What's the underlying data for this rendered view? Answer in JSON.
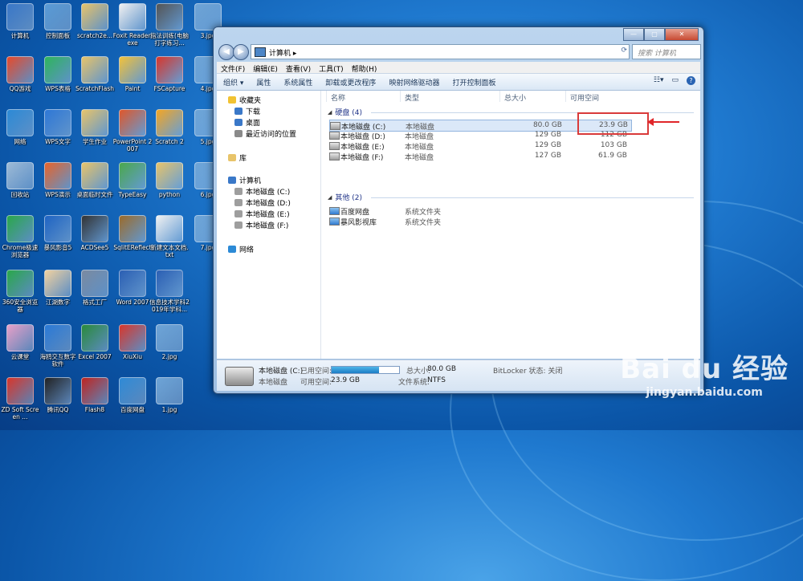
{
  "desktop": {
    "icons": [
      {
        "label": "计算机",
        "col": 0,
        "row": 0,
        "color": "#3a78c8"
      },
      {
        "label": "控制面板",
        "col": 1,
        "row": 0,
        "color": "#5a9bd6"
      },
      {
        "label": "scratch2e...",
        "col": 2,
        "row": 0,
        "color": "#e8c46a"
      },
      {
        "label": "Foxit Reader.exe",
        "col": 3,
        "row": 0,
        "color": "#f1f1f1"
      },
      {
        "label": "指法训练(电脑打字练习...",
        "col": 4,
        "row": 0,
        "color": "#555555"
      },
      {
        "label": "3.jpg",
        "col": 5,
        "row": 0,
        "color": "#6ea4d6"
      },
      {
        "label": "QQ游戏",
        "col": 0,
        "row": 1,
        "color": "#e84a2a"
      },
      {
        "label": "WPS表格",
        "col": 1,
        "row": 1,
        "color": "#2fb55c"
      },
      {
        "label": "ScratchFlash",
        "col": 2,
        "row": 1,
        "color": "#e8c46a"
      },
      {
        "label": "Paint",
        "col": 3,
        "row": 1,
        "color": "#f3c23b"
      },
      {
        "label": "FSCapture",
        "col": 4,
        "row": 1,
        "color": "#d9362a"
      },
      {
        "label": "4.jpg",
        "col": 5,
        "row": 1,
        "color": "#6ea4d6"
      },
      {
        "label": "网络",
        "col": 0,
        "row": 2,
        "color": "#2c8ad6"
      },
      {
        "label": "WPS文字",
        "col": 1,
        "row": 2,
        "color": "#2f78d6"
      },
      {
        "label": "学生作业",
        "col": 2,
        "row": 2,
        "color": "#e8c46a"
      },
      {
        "label": "PowerPoint 2007",
        "col": 3,
        "row": 2,
        "color": "#e0572a"
      },
      {
        "label": "Scratch 2",
        "col": 4,
        "row": 2,
        "color": "#f5a623"
      },
      {
        "label": "5.jpg",
        "col": 5,
        "row": 2,
        "color": "#6ea4d6"
      },
      {
        "label": "回收站",
        "col": 0,
        "row": 3,
        "color": "#9dbad6"
      },
      {
        "label": "WPS演示",
        "col": 1,
        "row": 3,
        "color": "#e8642a"
      },
      {
        "label": "桌面临时文件",
        "col": 2,
        "row": 3,
        "color": "#e8c46a"
      },
      {
        "label": "TypeEasy",
        "col": 3,
        "row": 3,
        "color": "#4ba84b"
      },
      {
        "label": "python",
        "col": 4,
        "row": 3,
        "color": "#e8c46a"
      },
      {
        "label": "6.jpg",
        "col": 5,
        "row": 3,
        "color": "#6ea4d6"
      },
      {
        "label": "Chrome极速浏览器",
        "col": 0,
        "row": 4,
        "color": "#2aa84a"
      },
      {
        "label": "暴风影音5",
        "col": 1,
        "row": 4,
        "color": "#1f64c3"
      },
      {
        "label": "ACDSee5",
        "col": 2,
        "row": 4,
        "color": "#333333"
      },
      {
        "label": "SqlitEReflect",
        "col": 3,
        "row": 4,
        "color": "#9c6b2a"
      },
      {
        "label": "新建文本文档.txt",
        "col": 4,
        "row": 4,
        "color": "#f1f1f1"
      },
      {
        "label": "7.jpg",
        "col": 5,
        "row": 4,
        "color": "#6ea4d6"
      },
      {
        "label": "360安全浏览器",
        "col": 0,
        "row": 5,
        "color": "#2aa84a"
      },
      {
        "label": "江湖数字",
        "col": 1,
        "row": 5,
        "color": "#f2d2a0"
      },
      {
        "label": "格式工厂",
        "col": 2,
        "row": 5,
        "color": "#7b8aa0"
      },
      {
        "label": "Word 2007",
        "col": 3,
        "row": 5,
        "color": "#2b5fb3"
      },
      {
        "label": "信息技术学科2019年学科...",
        "col": 4,
        "row": 5,
        "color": "#2b5fb3"
      },
      {
        "label": "云课堂",
        "col": 0,
        "row": 6,
        "color": "#e8a0c8"
      },
      {
        "label": "海鸥交互数字软件",
        "col": 1,
        "row": 6,
        "color": "#2b7ad6"
      },
      {
        "label": "Excel 2007",
        "col": 2,
        "row": 6,
        "color": "#2a8a3a"
      },
      {
        "label": "XiuXiu",
        "col": 3,
        "row": 6,
        "color": "#d9362a"
      },
      {
        "label": "2.jpg",
        "col": 4,
        "row": 6,
        "color": "#6ea4d6"
      },
      {
        "label": "ZD Soft Screen ...",
        "col": 0,
        "row": 7,
        "color": "#d9362a"
      },
      {
        "label": "腾讯QQ",
        "col": 1,
        "row": 7,
        "color": "#222222"
      },
      {
        "label": "Flash8",
        "col": 2,
        "row": 7,
        "color": "#c0241f"
      },
      {
        "label": "百度网盘",
        "col": 3,
        "row": 7,
        "color": "#2f8ad6"
      },
      {
        "label": "1.jpg",
        "col": 4,
        "row": 7,
        "color": "#6ea4d6"
      }
    ]
  },
  "window": {
    "caption_buttons": [
      "—",
      "▢",
      "✕"
    ],
    "address": "计算机 ▸",
    "search_placeholder": "搜索 计算机",
    "menu": [
      "文件(F)",
      "编辑(E)",
      "查看(V)",
      "工具(T)",
      "帮助(H)"
    ],
    "toolbar": [
      "组织 ▾",
      "属性",
      "系统属性",
      "卸载或更改程序",
      "映射网络驱动器",
      "打开控制面板"
    ],
    "nav": [
      {
        "label": "收藏夹",
        "color": "#f1c232"
      },
      {
        "label": "下载",
        "color": "#3a78c8"
      },
      {
        "label": "桌面",
        "color": "#3a78c8"
      },
      {
        "label": "最近访问的位置",
        "color": "#8a8a8a"
      },
      {
        "label": "库",
        "color": "#e8c46a"
      },
      {
        "label": "计算机",
        "color": "#3a78c8"
      },
      {
        "label": "本地磁盘 (C:)",
        "color": "#9e9e9e"
      },
      {
        "label": "本地磁盘 (D:)",
        "color": "#9e9e9e"
      },
      {
        "label": "本地磁盘 (E:)",
        "color": "#9e9e9e"
      },
      {
        "label": "本地磁盘 (F:)",
        "color": "#9e9e9e"
      },
      {
        "label": "网络",
        "color": "#2c8ad6"
      }
    ],
    "columns": [
      "名称",
      "类型",
      "总大小",
      "可用空间"
    ],
    "groups": [
      {
        "title": "硬盘 (4)"
      },
      {
        "title": "其他 (2)"
      }
    ],
    "drives": [
      {
        "name": "本地磁盘 (C:)",
        "type": "本地磁盘",
        "total": "80.0 GB",
        "free": "23.9 GB"
      },
      {
        "name": "本地磁盘 (D:)",
        "type": "本地磁盘",
        "total": "129 GB",
        "free": "112 GB"
      },
      {
        "name": "本地磁盘 (E:)",
        "type": "本地磁盘",
        "total": "129 GB",
        "free": "103 GB"
      },
      {
        "name": "本地磁盘 (F:)",
        "type": "本地磁盘",
        "total": "127 GB",
        "free": "61.9 GB"
      }
    ],
    "others": [
      {
        "name": "百度网盘",
        "type": "系统文件夹"
      },
      {
        "name": "暴风影视库",
        "type": "系统文件夹"
      }
    ],
    "details": {
      "name": "本地磁盘 (C:)",
      "kind": "本地磁盘",
      "used_label": "已用空间:",
      "used_fraction": 0.7,
      "free_label": "可用空间:",
      "free_value": "23.9 GB",
      "total_label": "总大小:",
      "total_value": "80.0 GB",
      "fs_label": "文件系统:",
      "fs_value": "NTFS",
      "bitlocker": "BitLocker 状态: 关闭"
    }
  },
  "watermark": {
    "brand": "Bai du 经验",
    "url": "jingyan.baidu.com"
  }
}
